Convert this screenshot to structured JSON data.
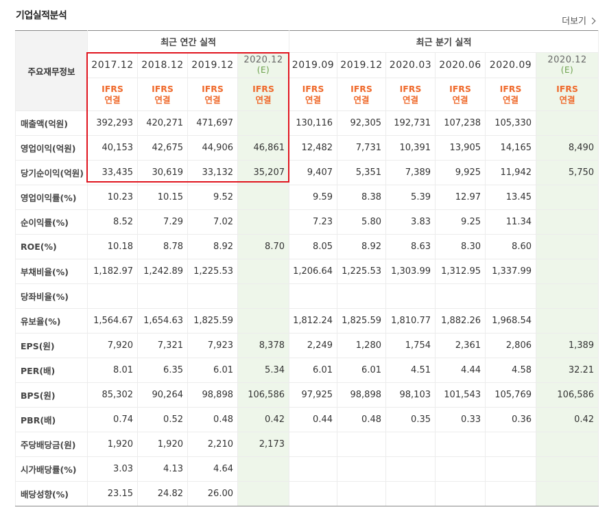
{
  "title": "기업실적분석",
  "more_label": "더보기",
  "corner_label": "주요재무정보",
  "groups": {
    "annual": "최근 연간 실적",
    "quarter": "최근 분기 실적"
  },
  "periods": [
    {
      "date": "2017.12",
      "est": "",
      "ifrs": "IFRS",
      "consol": "연결"
    },
    {
      "date": "2018.12",
      "est": "",
      "ifrs": "IFRS",
      "consol": "연결"
    },
    {
      "date": "2019.12",
      "est": "",
      "ifrs": "IFRS",
      "consol": "연결"
    },
    {
      "date": "2020.12",
      "est": "(E)",
      "ifrs": "IFRS",
      "consol": "연결"
    },
    {
      "date": "2019.09",
      "est": "",
      "ifrs": "IFRS",
      "consol": "연결"
    },
    {
      "date": "2019.12",
      "est": "",
      "ifrs": "IFRS",
      "consol": "연결"
    },
    {
      "date": "2020.03",
      "est": "",
      "ifrs": "IFRS",
      "consol": "연결"
    },
    {
      "date": "2020.06",
      "est": "",
      "ifrs": "IFRS",
      "consol": "연결"
    },
    {
      "date": "2020.09",
      "est": "",
      "ifrs": "IFRS",
      "consol": "연결"
    },
    {
      "date": "2020.12",
      "est": "(E)",
      "ifrs": "IFRS",
      "consol": "연결"
    }
  ],
  "rows": [
    {
      "label": "매출액(억원)",
      "values": [
        "392,293",
        "420,271",
        "471,697",
        "",
        "130,116",
        "92,305",
        "192,731",
        "107,238",
        "105,330",
        ""
      ]
    },
    {
      "label": "영업이익(억원)",
      "values": [
        "40,153",
        "42,675",
        "44,906",
        "46,861",
        "12,482",
        "7,731",
        "10,391",
        "13,905",
        "14,165",
        "8,490"
      ]
    },
    {
      "label": "당기순이익(억원)",
      "values": [
        "33,435",
        "30,619",
        "33,132",
        "35,207",
        "9,407",
        "5,351",
        "7,389",
        "9,925",
        "11,942",
        "5,750"
      ]
    },
    {
      "label": "영업이익률(%)",
      "values": [
        "10.23",
        "10.15",
        "9.52",
        "",
        "9.59",
        "8.38",
        "5.39",
        "12.97",
        "13.45",
        ""
      ]
    },
    {
      "label": "순이익률(%)",
      "values": [
        "8.52",
        "7.29",
        "7.02",
        "",
        "7.23",
        "5.80",
        "3.83",
        "9.25",
        "11.34",
        ""
      ]
    },
    {
      "label": "ROE(%)",
      "values": [
        "10.18",
        "8.78",
        "8.92",
        "8.70",
        "8.05",
        "8.92",
        "8.63",
        "8.30",
        "8.60",
        ""
      ]
    },
    {
      "label": "부채비율(%)",
      "values": [
        "1,182.97",
        "1,242.89",
        "1,225.53",
        "",
        "1,206.64",
        "1,225.53",
        "1,303.99",
        "1,312.95",
        "1,337.99",
        ""
      ]
    },
    {
      "label": "당좌비율(%)",
      "values": [
        "",
        "",
        "",
        "",
        "",
        "",
        "",
        "",
        "",
        ""
      ]
    },
    {
      "label": "유보율(%)",
      "values": [
        "1,564.67",
        "1,654.63",
        "1,825.59",
        "",
        "1,812.24",
        "1,825.59",
        "1,810.77",
        "1,882.26",
        "1,968.54",
        ""
      ]
    },
    {
      "label": "EPS(원)",
      "values": [
        "7,920",
        "7,321",
        "7,923",
        "8,378",
        "2,249",
        "1,280",
        "1,754",
        "2,361",
        "2,806",
        "1,389"
      ]
    },
    {
      "label": "PER(배)",
      "values": [
        "8.01",
        "6.35",
        "6.01",
        "5.34",
        "6.01",
        "6.01",
        "4.51",
        "4.44",
        "4.58",
        "32.21"
      ]
    },
    {
      "label": "BPS(원)",
      "values": [
        "85,302",
        "90,264",
        "98,898",
        "106,586",
        "97,925",
        "98,898",
        "98,103",
        "101,543",
        "105,769",
        "106,586"
      ]
    },
    {
      "label": "PBR(배)",
      "values": [
        "0.74",
        "0.52",
        "0.48",
        "0.42",
        "0.44",
        "0.48",
        "0.35",
        "0.33",
        "0.36",
        "0.42"
      ]
    },
    {
      "label": "주당배당금(원)",
      "values": [
        "1,920",
        "1,920",
        "2,210",
        "2,173",
        "",
        "",
        "",
        "",
        "",
        ""
      ]
    },
    {
      "label": "시가배당률(%)",
      "values": [
        "3.03",
        "4.13",
        "4.64",
        "",
        "",
        "",
        "",
        "",
        "",
        ""
      ]
    },
    {
      "label": "배당성향(%)",
      "values": [
        "23.15",
        "24.82",
        "26.00",
        "",
        "",
        "",
        "",
        "",
        "",
        ""
      ]
    }
  ],
  "colors": {
    "ifrs": "#ef6a2c",
    "estimate_bg": "#eef6ea",
    "highlight": "#e0141e"
  }
}
